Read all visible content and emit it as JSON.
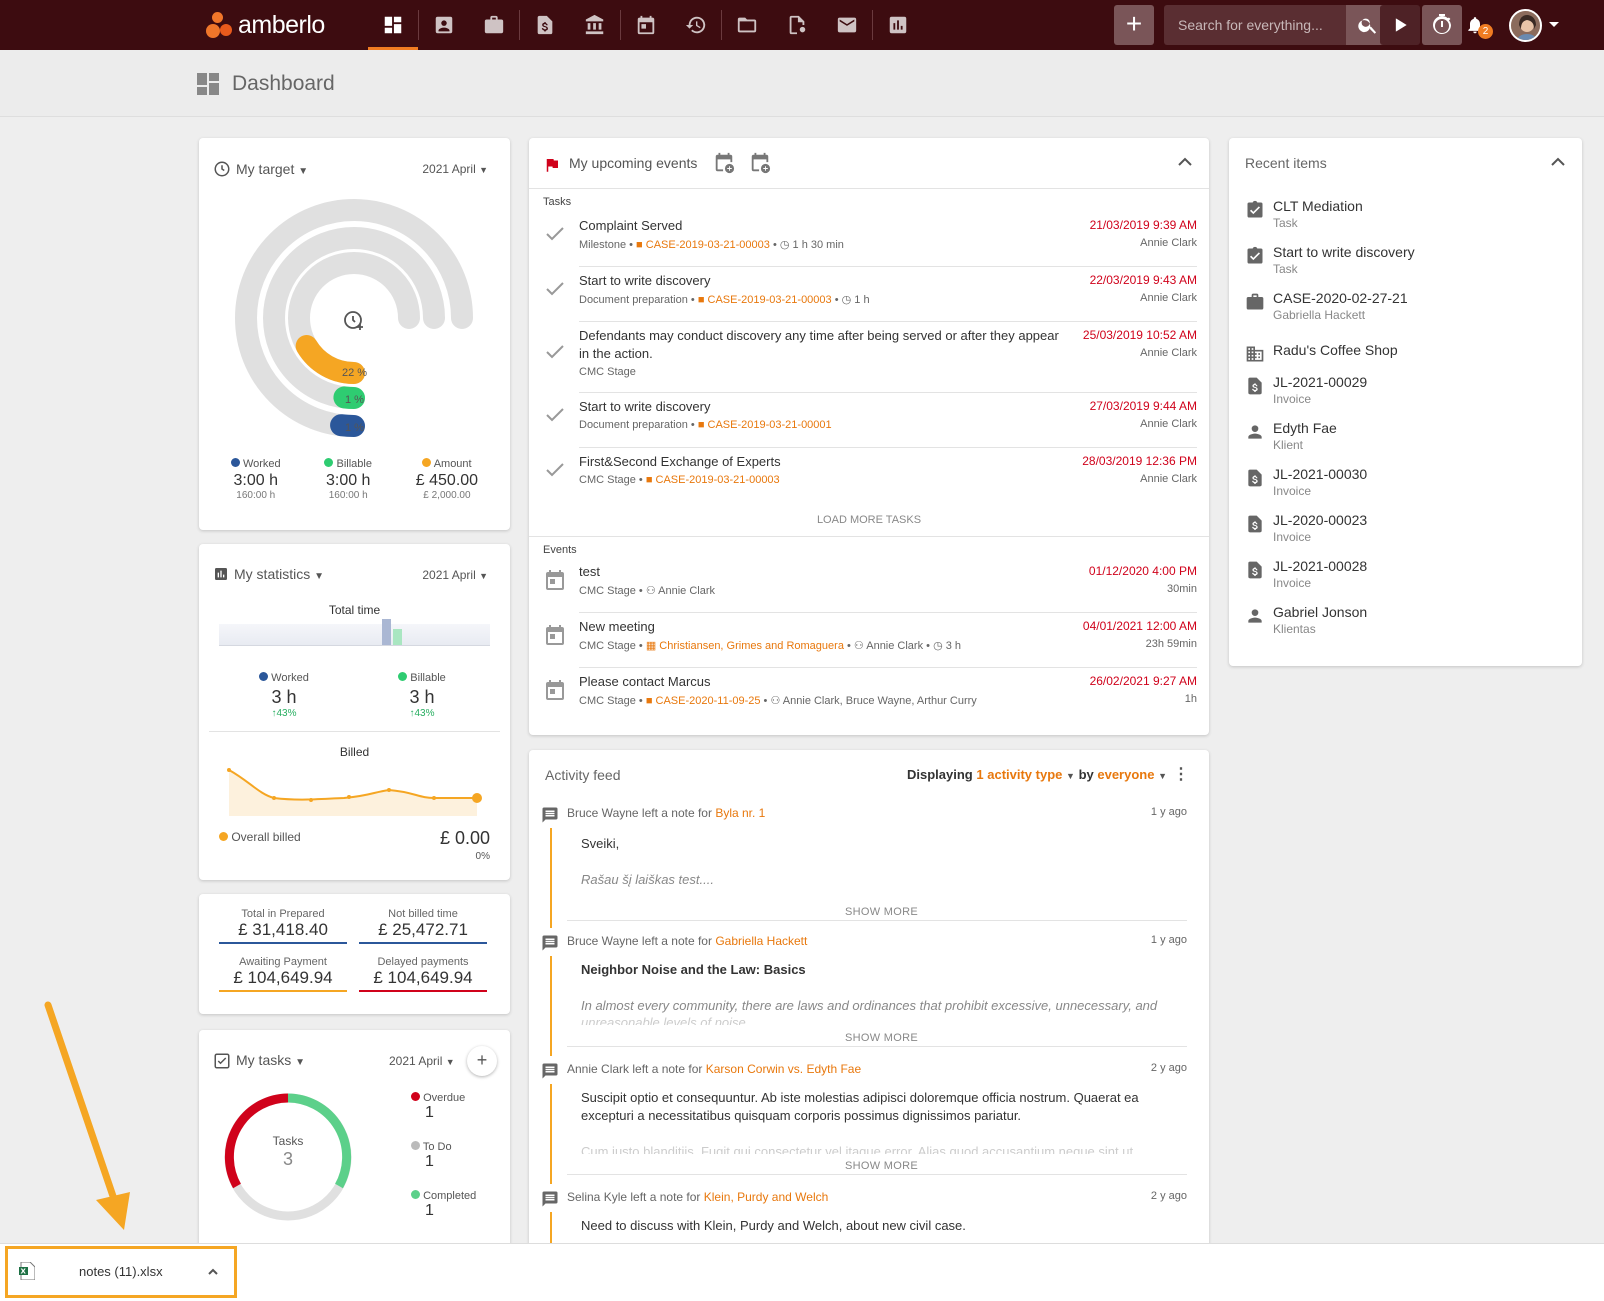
{
  "app": {
    "logo": "amberlo",
    "page_title": "Dashboard"
  },
  "search": {
    "placeholder": "Search for everything..."
  },
  "notifications": {
    "count": "2"
  },
  "target": {
    "title": "My target",
    "period": "2021 April",
    "rings": [
      {
        "pct": "22 %",
        "value": 0.22,
        "color": "#f5a623"
      },
      {
        "pct": "1 %",
        "value": 0.01,
        "color": "#2ecc71"
      },
      {
        "pct": "1 %",
        "value": 0.01,
        "color": "#2b579a"
      }
    ],
    "legend": [
      {
        "label": "Worked",
        "value": "3:00 h",
        "sub": "160:00 h",
        "color": "#2b579a"
      },
      {
        "label": "Billable",
        "value": "3:00 h",
        "sub": "160:00 h",
        "color": "#2ecc71"
      },
      {
        "label": "Amount",
        "value": "£ 450.00",
        "sub": "£ 2,000.00",
        "color": "#f5a623"
      }
    ]
  },
  "statistics": {
    "title": "My statistics",
    "period": "2021 April",
    "total_time_label": "Total time",
    "worked": {
      "label": "Worked",
      "value": "3 h",
      "change": "43%"
    },
    "billable": {
      "label": "Billable",
      "value": "3 h",
      "change": "43%"
    },
    "billed_label": "Billed",
    "overall_label": "Overall billed",
    "overall_value": "£ 0.00",
    "overall_pct": "0%"
  },
  "finance": [
    {
      "label": "Total in Prepared",
      "value": "£ 31,418.40",
      "color": "#2b579a"
    },
    {
      "label": "Not billed time",
      "value": "£ 25,472.71",
      "color": "#2b579a"
    },
    {
      "label": "Awaiting Payment",
      "value": "£ 104,649.94",
      "color": "#f5a623"
    },
    {
      "label": "Delayed payments",
      "value": "£ 104,649.94",
      "color": "#d0021b"
    }
  ],
  "mytasks": {
    "title": "My tasks",
    "period": "2021 April",
    "center_label": "Tasks",
    "center_value": "3",
    "legend": [
      {
        "label": "Overdue",
        "value": "1",
        "color": "#d0021b"
      },
      {
        "label": "To Do",
        "value": "1",
        "color": "#bbbbbb"
      },
      {
        "label": "Completed",
        "value": "1",
        "color": "#5cd08a"
      }
    ]
  },
  "events": {
    "title": "My upcoming events",
    "tasks_heading": "Tasks",
    "events_heading": "Events",
    "load_more": "LOAD MORE TASKS",
    "tasks": [
      {
        "name": "Complaint Served",
        "type": "Milestone",
        "case": "CASE-2019-03-21-00003",
        "dur": "1 h 30 min",
        "date": "21/03/2019 9:39 AM",
        "who": "Annie Clark"
      },
      {
        "name": "Start to write discovery",
        "type": "Document preparation",
        "case": "CASE-2019-03-21-00003",
        "dur": "1 h",
        "date": "22/03/2019 9:43 AM",
        "who": "Annie Clark"
      },
      {
        "name": "Defendants may conduct discovery any time after being served or after they appear",
        "name2": "in the action.",
        "type": "CMC Stage",
        "date": "25/03/2019 10:52 AM",
        "who": "Annie Clark"
      },
      {
        "name": "Start to write discovery",
        "type": "Document preparation",
        "case": "CASE-2019-03-21-00001",
        "date": "27/03/2019 9:44 AM",
        "who": "Annie Clark"
      },
      {
        "name": "First&Second Exchange of Experts",
        "type": "CMC Stage",
        "case": "CASE-2019-03-21-00003",
        "date": "28/03/2019 12:36 PM",
        "who": "Annie Clark"
      }
    ],
    "events": [
      {
        "name": "test",
        "type": "CMC Stage",
        "people": "Annie Clark",
        "date": "01/12/2020 4:00 PM",
        "dur": "30min"
      },
      {
        "name": "New meeting",
        "type": "CMC Stage",
        "case": "Christiansen, Grimes and Romaguera",
        "people": "Annie Clark",
        "extra": "3 h",
        "date": "04/01/2021 12:00 AM",
        "dur": "23h 59min"
      },
      {
        "name": "Please contact Marcus",
        "type": "CMC Stage",
        "case": "CASE-2020-11-09-25",
        "people": "Annie Clark, Bruce Wayne, Arthur Curry",
        "date": "26/02/2021 9:27 AM",
        "dur": "1h"
      }
    ]
  },
  "recent": {
    "title": "Recent items",
    "items": [
      {
        "name": "CLT Mediation",
        "sub": "Task",
        "icon": "task-icon"
      },
      {
        "name": "Start to write discovery",
        "sub": "Task",
        "icon": "task-icon"
      },
      {
        "name": "CASE-2020-02-27-21",
        "sub": "Gabriella Hackett",
        "icon": "case-icon"
      },
      {
        "name": "Radu's Coffee Shop",
        "sub": "",
        "icon": "company-icon"
      },
      {
        "name": "JL-2021-00029",
        "sub": "Invoice",
        "icon": "invoice-icon"
      },
      {
        "name": "Edyth Fae",
        "sub": "Klient",
        "icon": "person-icon"
      },
      {
        "name": "JL-2021-00030",
        "sub": "Invoice",
        "icon": "invoice-icon"
      },
      {
        "name": "JL-2020-00023",
        "sub": "Invoice",
        "icon": "invoice-icon"
      },
      {
        "name": "JL-2021-00028",
        "sub": "Invoice",
        "icon": "invoice-icon"
      },
      {
        "name": "Gabriel Jonson",
        "sub": "Klientas",
        "icon": "person-icon"
      }
    ]
  },
  "feed": {
    "title": "Activity feed",
    "displaying": "Displaying",
    "filter1": "1 activity type",
    "by": "by",
    "filter2": "everyone",
    "show_more": "SHOW MORE",
    "items": [
      {
        "author": "Bruce Wayne left a note for",
        "target": "Byla nr. 1",
        "ago": "1 y ago",
        "l1": "Sveiki,",
        "l2": "Rašau šį laiškas test...."
      },
      {
        "author": "Bruce Wayne left a note for",
        "target": "Gabriella Hackett",
        "ago": "1 y ago",
        "l1": "Neighbor Noise and the Law: Basics",
        "l2": "In almost every community, there are laws and ordinances that prohibit excessive, unnecessary, and",
        "l3": "unreasonable levels of noise."
      },
      {
        "author": "Annie Clark left a note for",
        "target": "Karson Corwin vs. Edyth Fae",
        "ago": "2 y ago",
        "l1": "Suscipit optio et consequuntur. Ab iste molestias adipisci doloremque officia nostrum. Quaerat ea",
        "l2": "excepturi a necessitatibus quisquam corporis possimus dignissimos pariatur.",
        "l3": "Cum iusto blanditiis. Fugit qui consectetur vel itaque error. Alias quod accusantium neque sint ut"
      },
      {
        "author": "Selina Kyle left a note for",
        "target": "Klein, Purdy and Welch",
        "ago": "2 y ago",
        "l1": "Need to discuss with Klein, Purdy and Welch, about new civil case."
      }
    ]
  },
  "download": {
    "file": "notes (11).xlsx"
  },
  "colors": {
    "topbar": "#3d0c10",
    "accent": "#f07c22",
    "danger": "#d0021b"
  }
}
